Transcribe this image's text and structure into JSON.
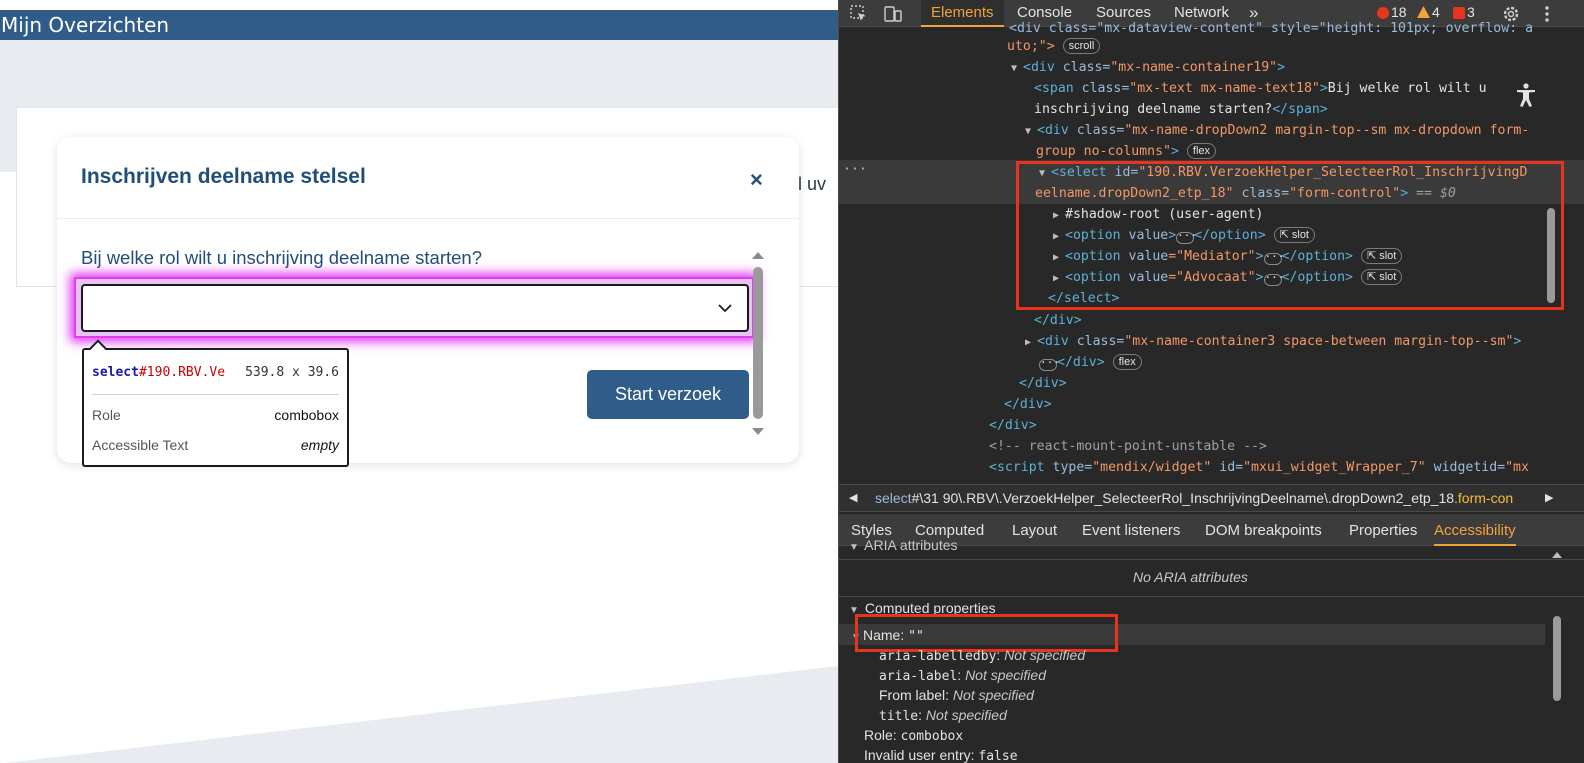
{
  "app": {
    "header_title": "Mijn Overzichten",
    "background_card_text": "al uv",
    "modal": {
      "title": "Inschrijven deelname stelsel",
      "close_glyph": "×",
      "question": "Bij welke rol wilt u inschrijving deelname starten?",
      "select_value": "",
      "start_button": "Start verzoek"
    },
    "inspect_tooltip": {
      "selector_tag": "select",
      "selector_id": "#190.RBV.Ve",
      "dimensions": "539.8 x 39.6",
      "role_label": "Role",
      "role_value": "combobox",
      "accessible_text_label": "Accessible Text",
      "accessible_text_value": "empty"
    }
  },
  "devtools": {
    "tabs": [
      "Elements",
      "Console",
      "Sources",
      "Network"
    ],
    "active_tab": "Elements",
    "more_tabs": "»",
    "counts": {
      "errors": "18",
      "warnings": "4",
      "issues": "3"
    },
    "dom_lines": {
      "l0_a": "<div class=\"mx-dataview-content\" style=\"height: 101px; overflow: a",
      "l0_b": "uto;\">",
      "l0_pill": "scroll",
      "l1_tag": "<div",
      "l1_attr": " class=",
      "l1_val": "\"mx-name-container19\"",
      "l1_end": ">",
      "l2_tag": "<span",
      "l2_attr": " class=",
      "l2_val": "\"mx-text mx-name-text18\"",
      "l2_end": ">",
      "l2_text": "Bij welke rol wilt u",
      "l3_text": "inschrijving deelname starten?",
      "l3_close": "</span>",
      "l4_tag": "<div",
      "l4_attr": " class=",
      "l4_val": "\"mx-name-dropDown2 margin-top--sm mx-dropdown form-",
      "l5_val": "group no-columns\"",
      "l5_end": ">",
      "l5_pill": "flex",
      "l6_tag": "<select",
      "l6_attr": " id=",
      "l6_val": "\"190.RBV.VerzoekHelper_SelecteerRol_InschrijvingD",
      "l7_val": "eelname.dropDown2_etp_18\"",
      "l7_attr": " class=",
      "l7_val2": "\"form-control\"",
      "l7_end": ">",
      "l7_eq": " == $0",
      "l8_text": "#shadow-root (user-agent)",
      "opt_tag": "<option",
      "opt_attr": " value",
      "opt1_val": "",
      "opt2_val": "=\"Mediator\"",
      "opt3_val": "=\"Advocaat\"",
      "opt_close": "</option>",
      "slot_pill": "slot",
      "l12": "</select>",
      "l13": "</div>",
      "l14_tag": "<div",
      "l14_attr": " class=",
      "l14_val": "\"mx-name-container3 space-between margin-top--sm\"",
      "l14_end": ">",
      "l15_close": "</div>",
      "l15_pill": "flex",
      "l16": "</div>",
      "l17": "</div>",
      "l18": "</div>",
      "l19": "<!-- react-mount-point-unstable -->",
      "l20_tag": "<script",
      "l20_attr1": " type=",
      "l20_val1": "\"mendix/widget\"",
      "l20_attr2": " id=",
      "l20_val2": "\"mxui_widget_Wrapper_7\"",
      "l20_attr3": " widgetid=",
      "l20_val3": "\"mx",
      "ellipsis": "···"
    },
    "breadcrumb": {
      "prefix": "select",
      "path": "#\\31 90\\.RBV\\.VerzoekHelper_SelecteerRol_InschrijvingDeelname\\.dropDown2_etp_18",
      "cls": ".form-con"
    },
    "subtabs": [
      "Styles",
      "Computed",
      "Layout",
      "Event listeners",
      "DOM breakpoints",
      "Properties",
      "Accessibility"
    ],
    "active_subtab": "Accessibility",
    "accessibility": {
      "aria_header": "ARIA attributes",
      "no_aria": "No ARIA attributes",
      "computed_header": "Computed properties",
      "name_label": "Name: ",
      "name_value": "\"\"",
      "labelledby_key": "aria-labelledby",
      "labelledby_val": "Not specified",
      "arialabel_key": "aria-label",
      "arialabel_val": "Not specified",
      "fromlabel_key": "From label",
      "fromlabel_val": "Not specified",
      "title_key": "title",
      "title_val": "Not specified",
      "role_key": "Role: ",
      "role_val": "combobox",
      "invalid_key": "Invalid user entry: ",
      "invalid_val": "false"
    }
  }
}
